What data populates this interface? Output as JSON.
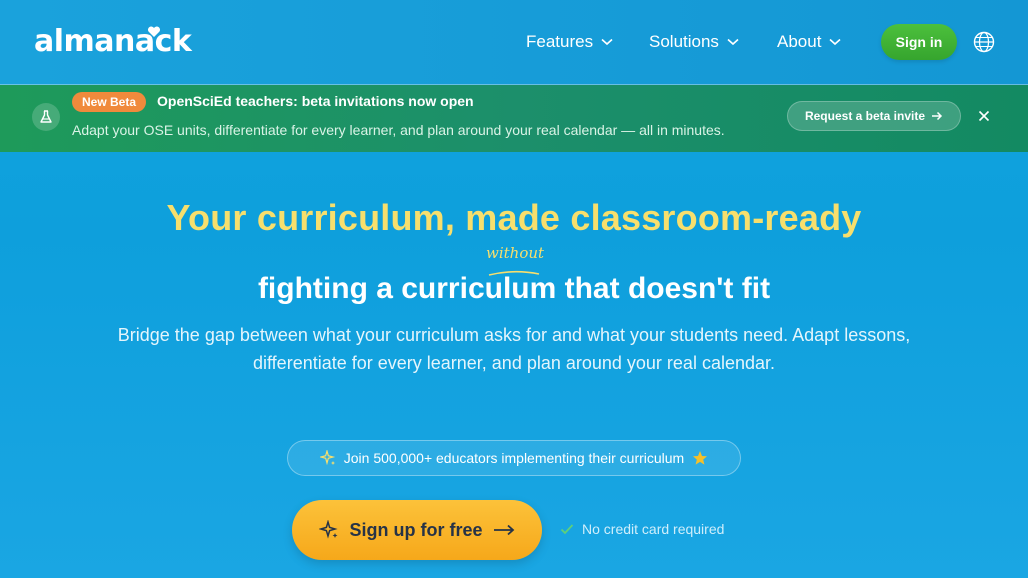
{
  "nav": {
    "logo": "almanack",
    "items": [
      {
        "label": "Features"
      },
      {
        "label": "Solutions"
      },
      {
        "label": "About"
      }
    ],
    "signin_label": "Sign in"
  },
  "banner": {
    "badge": "New Beta",
    "title": "OpenSciEd teachers: beta invitations now open",
    "subtitle": "Adapt your OSE units, differentiate for every learner, and plan around your real calendar — all in minutes.",
    "cta_label": "Request a beta invite"
  },
  "hero": {
    "title": "Your curriculum, made classroom-ready",
    "annotation": "without",
    "subtitle": "fighting a curriculum that doesn't fit",
    "description": "Bridge the gap between what your curriculum asks for and what your students need. Adapt lessons, differentiate for every learner, and plan around your real calendar.",
    "join_text": "Join 500,000+ educators implementing their curriculum",
    "cta_label": "Sign up for free",
    "no_card_text": "No credit card required"
  },
  "colors": {
    "accent_yellow": "#f7df6d",
    "signin_green": "#36a52e",
    "banner_green": "#1c8f6b",
    "badge_orange": "#f08a3c",
    "cta_yellow": "#f6a81a"
  },
  "icons": [
    "heart-icon",
    "chevron-down-icon",
    "globe-icon",
    "flask-icon",
    "arrow-right-icon",
    "close-icon",
    "sparkle-icon",
    "star-icon",
    "check-icon"
  ]
}
